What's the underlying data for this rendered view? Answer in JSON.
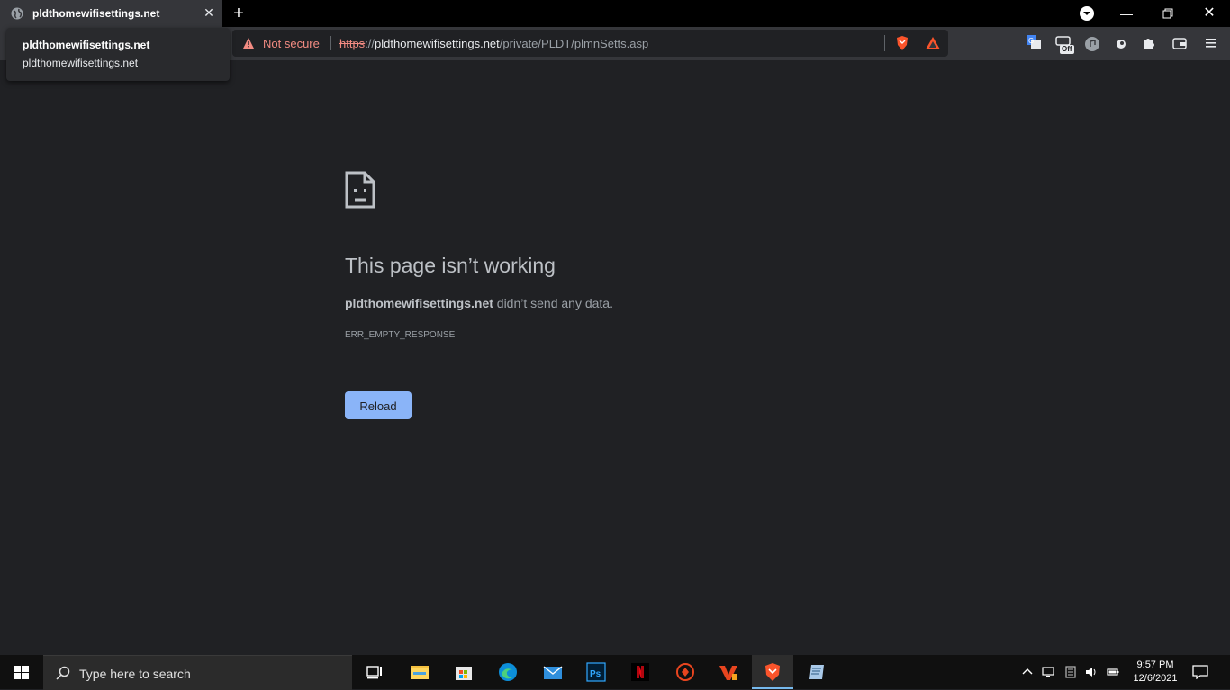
{
  "tab": {
    "title": "pldthomewifisettings.net"
  },
  "tooltip": {
    "title": "pldthomewifisettings.net",
    "subtitle": "pldthomewifisettings.net"
  },
  "omnibox": {
    "security_label": "Not secure",
    "url_scheme": "https",
    "url_sep": "://",
    "url_host": "pldthomewifisettings.net",
    "url_path": "/private/PLDT/plmnSetts.asp"
  },
  "extensions": {
    "off_badge": "Off"
  },
  "error": {
    "heading": "This page isn’t working",
    "detail_host": "pldthomewifisettings.net",
    "detail_text": " didn’t send any data.",
    "code": "ERR_EMPTY_RESPONSE",
    "reload_label": "Reload"
  },
  "taskbar": {
    "search_placeholder": "Type here to search",
    "time": "9:57 PM",
    "date": "12/6/2021",
    "apps": [
      "task-view",
      "file-explorer",
      "microsoft-store",
      "edge",
      "mail",
      "photoshop",
      "netflix",
      "game-app",
      "vivaldi",
      "brave",
      "notepad-app"
    ]
  },
  "colors": {
    "background": "#202124",
    "toolbar": "#35363a",
    "not_secure": "#f28b82",
    "reload_button": "#8ab4f8",
    "taskbar": "#101010"
  }
}
